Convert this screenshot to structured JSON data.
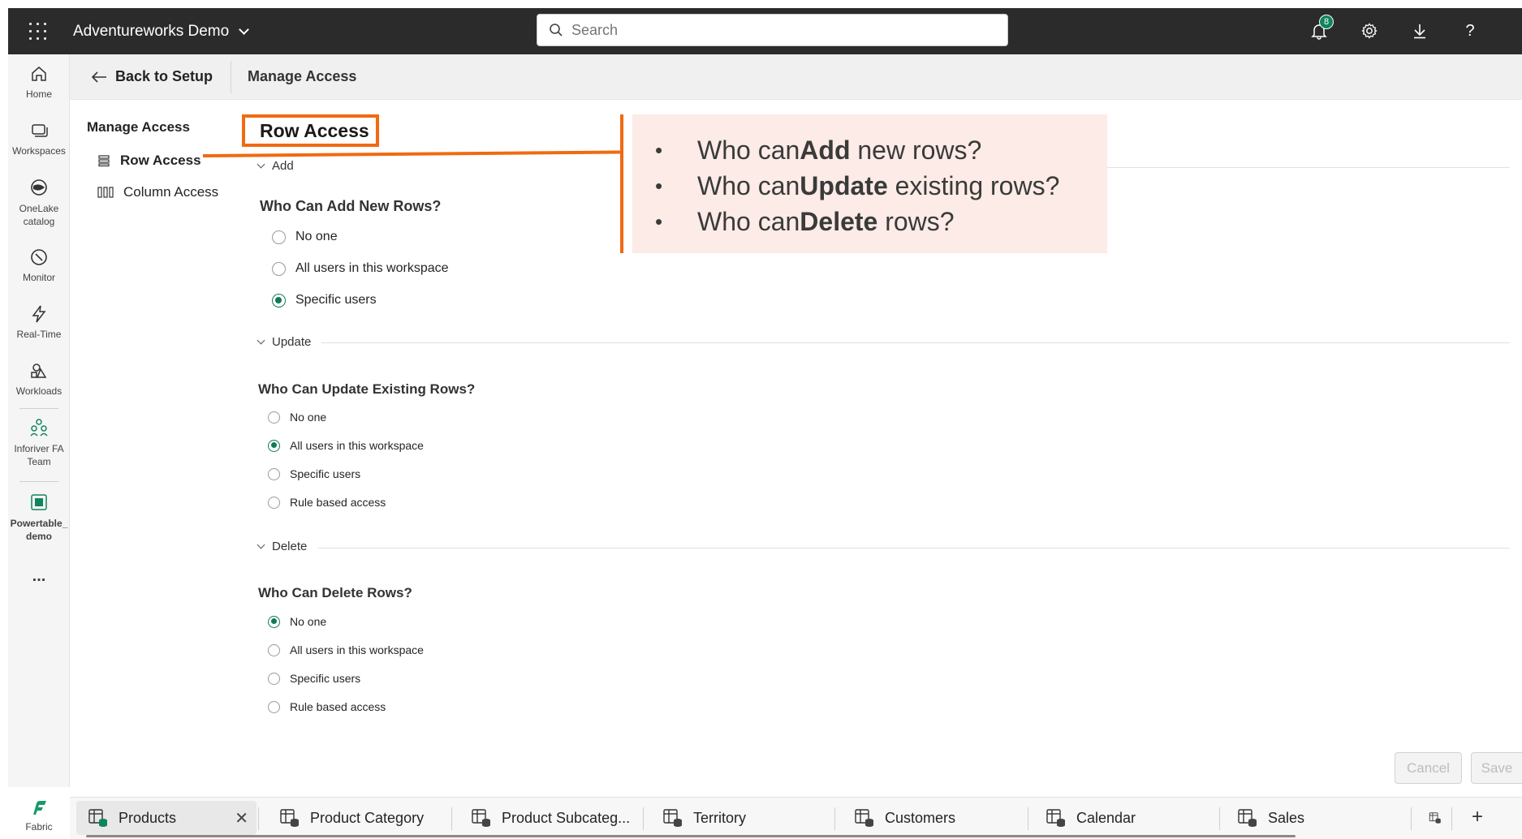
{
  "topbar": {
    "app_title": "Adventureworks Demo",
    "search_placeholder": "Search",
    "notification_count": "8"
  },
  "rail": {
    "items": [
      {
        "label": "Home",
        "icon": "home-icon"
      },
      {
        "label": "Workspaces",
        "icon": "workspaces-icon"
      },
      {
        "label": "OneLake catalog",
        "icon": "onelake-icon"
      },
      {
        "label": "Monitor",
        "icon": "monitor-icon"
      },
      {
        "label": "Real-Time",
        "icon": "real-time-icon"
      },
      {
        "label": "Workloads",
        "icon": "workloads-icon"
      },
      {
        "label": "Inforiver FA Team",
        "icon": "team-icon"
      },
      {
        "label": "Powertable_ demo",
        "icon": "powertable-icon"
      },
      {
        "label": "...",
        "icon": "more-icon"
      }
    ],
    "footer_label": "Fabric"
  },
  "subheader": {
    "back_label": "Back to Setup",
    "title": "Manage Access"
  },
  "nav": {
    "title": "Manage Access",
    "items": [
      {
        "label": "Row Access",
        "active": true
      },
      {
        "label": "Column Access",
        "active": false
      }
    ]
  },
  "content": {
    "title": "Row Access",
    "callout": [
      {
        "pre": "Who can ",
        "bold": "Add",
        "post": " new rows?"
      },
      {
        "pre": "Who can ",
        "bold": "Update",
        "post": " existing rows?"
      },
      {
        "pre": "Who can ",
        "bold": "Delete",
        "post": " rows?"
      }
    ],
    "sections": {
      "add": {
        "header": "Add",
        "question": "Who Can Add New Rows?",
        "options": [
          "No one",
          "All users in this workspace",
          "Specific users"
        ],
        "selected": "Specific users"
      },
      "update": {
        "header": "Update",
        "question": "Who Can Update Existing Rows?",
        "options": [
          "No one",
          "All users in this workspace",
          "Specific users",
          "Rule based access"
        ],
        "selected": "All users in this workspace"
      },
      "delete": {
        "header": "Delete",
        "question": "Who Can Delete Rows?",
        "options": [
          "No one",
          "All users in this workspace",
          "Specific users",
          "Rule based access"
        ],
        "selected": "No one"
      }
    },
    "buttons": {
      "cancel": "Cancel",
      "save": "Save"
    }
  },
  "tabs": [
    "Products",
    "Product Category",
    "Product Subcateg...",
    "Territory",
    "Customers",
    "Calendar",
    "Sales"
  ],
  "colors": {
    "accent_orange": "#f06a12",
    "radio_green": "#11795a",
    "topbar": "#2b2b2b",
    "callout_bg": "#fcebe6"
  }
}
